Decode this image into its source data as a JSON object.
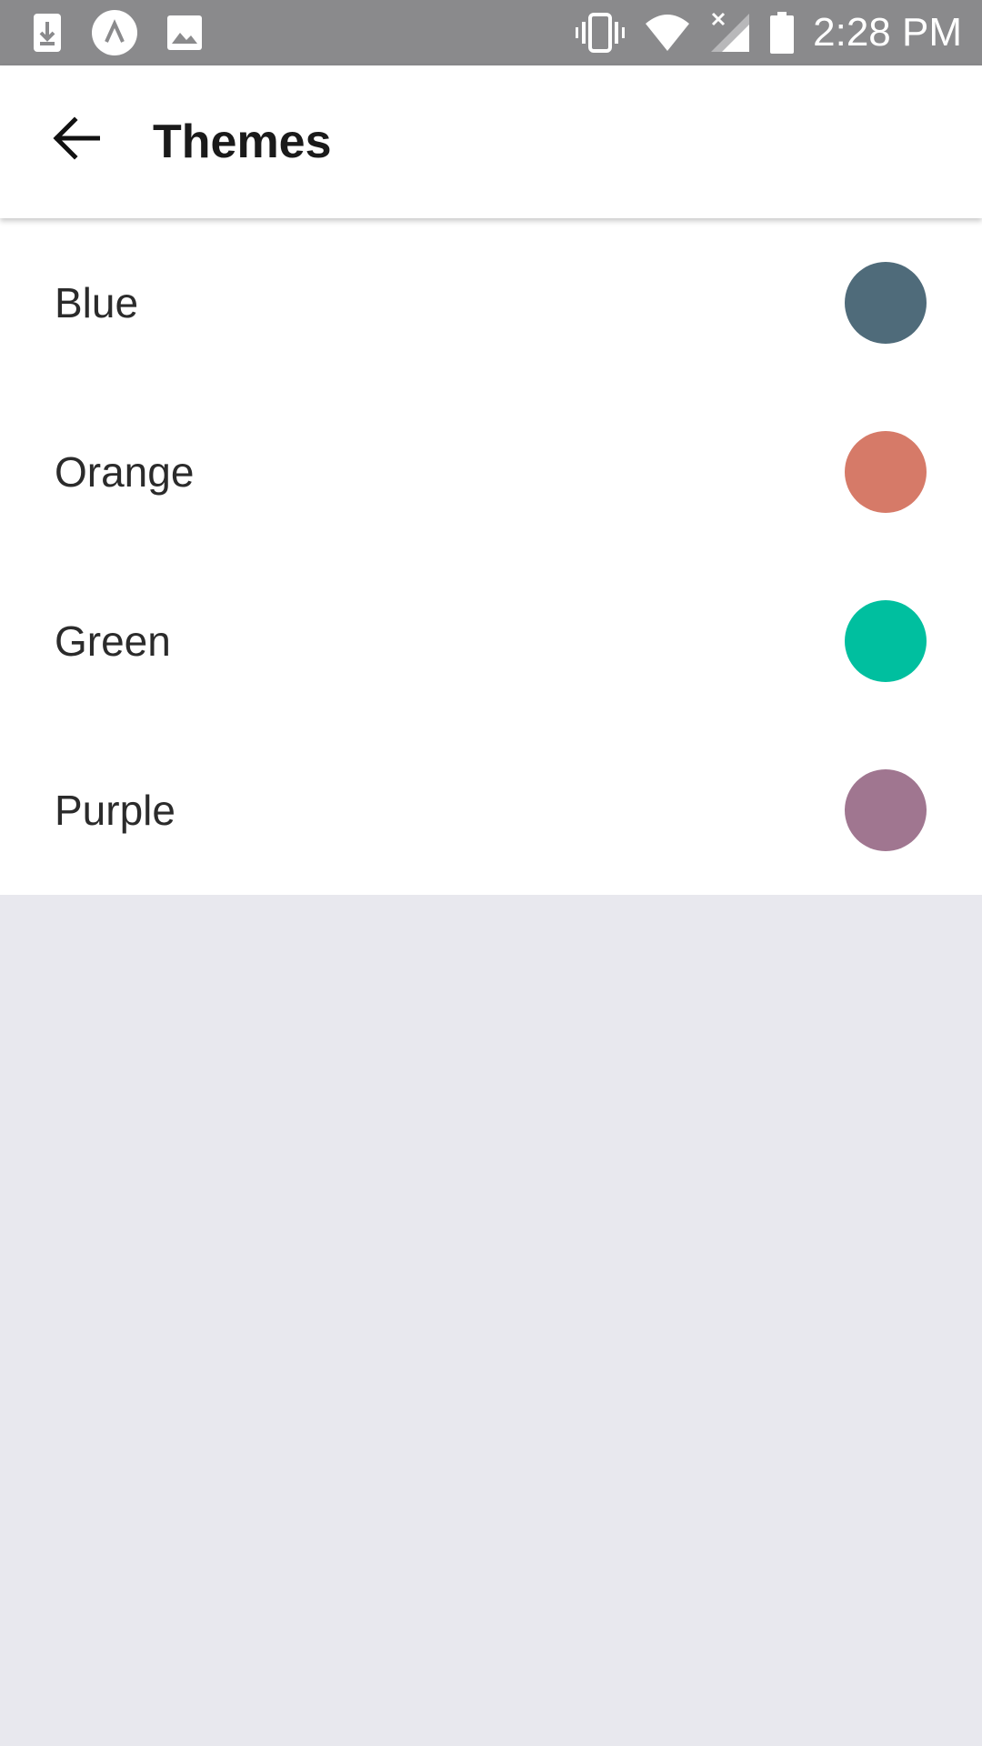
{
  "status_bar": {
    "time": "2:28 PM",
    "left_icons": [
      "download-notification-icon",
      "app-notification-icon",
      "image-notification-icon"
    ],
    "right_icons": [
      "vibrate-icon",
      "wifi-icon",
      "cell-signal-icon",
      "battery-icon"
    ]
  },
  "header": {
    "title": "Themes",
    "back_icon": "arrow-left-icon"
  },
  "themes": [
    {
      "label": "Blue",
      "color": "#4f6b7a"
    },
    {
      "label": "Orange",
      "color": "#d67a68"
    },
    {
      "label": "Green",
      "color": "#00bf9f"
    },
    {
      "label": "Purple",
      "color": "#a07690"
    }
  ]
}
